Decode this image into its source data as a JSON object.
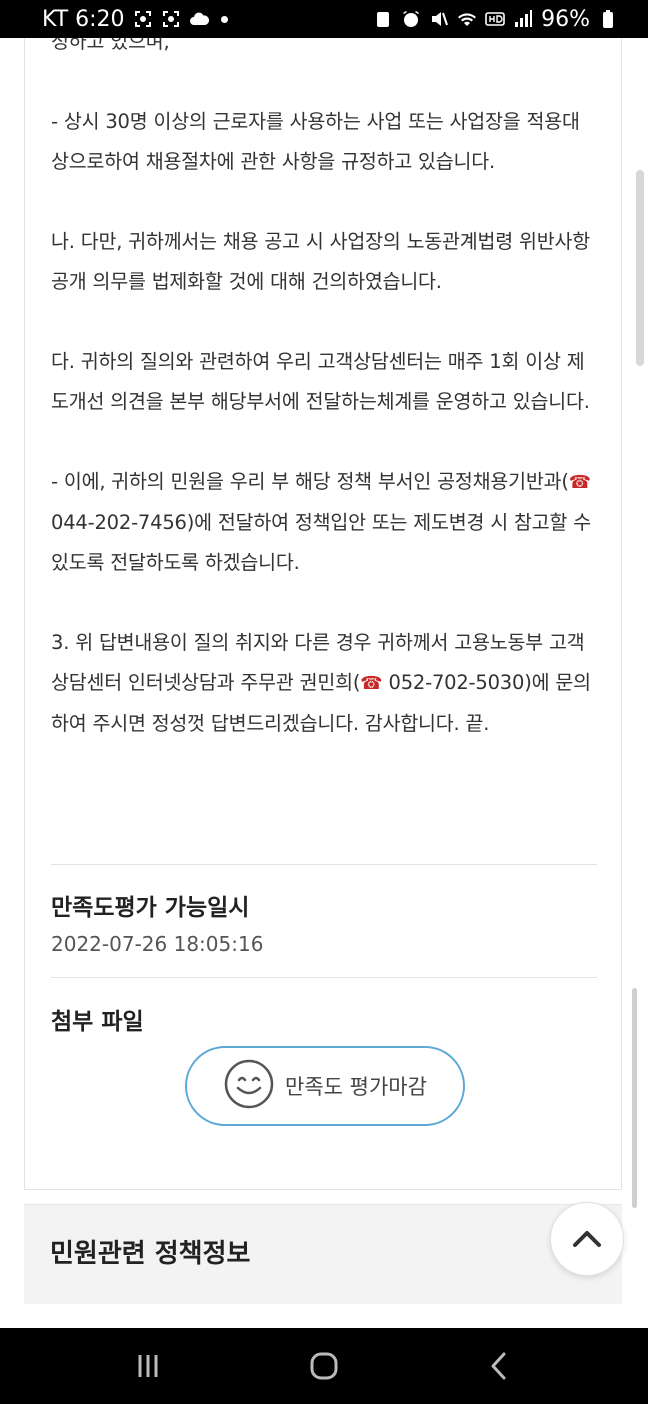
{
  "status_bar": {
    "carrier_time": "KT 6:20",
    "battery": "96%",
    "icons": [
      "screenshot-icon",
      "screenshot-icon",
      "cloud-icon",
      "notification-dot",
      "lock-icon",
      "alarm-icon",
      "mute-icon",
      "wifi-icon",
      "hd-icon",
      "signal-icon",
      "battery-icon"
    ]
  },
  "answer": {
    "top_fragment": "정하고 있으며,",
    "p1": "- 상시 30명 이상의 근로자를 사용하는 사업 또는 사업장을 적용대상으로하여 채용절차에 관한 사항을 규정하고 있습니다.",
    "p2": "나. 다만, 귀하께서는 채용 공고 시 사업장의 노동관계법령 위반사항 공개 의무를 법제화할 것에 대해 건의하였습니다.",
    "p3": "다. 귀하의 질의와 관련하여 우리 고객상담센터는 매주 1회 이상 제도개선 의견을 본부 해당부서에 전달하는체계를 운영하고 있습니다.",
    "p4_before": "- 이에, 귀하의 민원을 우리 부 해당 정책 부서인 공정채용기반과(",
    "p4_tel": "044-202-7456",
    "p4_after": ")에 전달하여 정책입안 또는 제도변경 시 참고할 수 있도록 전달하도록 하겠습니다.",
    "p5_before": "3. 위 답변내용이 질의 취지와 다른 경우 귀하께서 고용노동부 고객상담센터 인터넷상담과 주무관 권민희(",
    "p5_tel": "052-702-5030",
    "p5_after": ")에 문의하여 주시면 정성껏 답변드리겠습니다. 감사합니다. 끝."
  },
  "satisfaction": {
    "label": "만족도평가 가능일시",
    "datetime": "2022-07-26 18:05:16"
  },
  "attachment": {
    "label": "첨부 파일"
  },
  "rate_button": {
    "label": "만족도 평가마감",
    "icon": "smile-icon"
  },
  "policy": {
    "title": "민원관련 정책정보"
  },
  "colors": {
    "accent_border": "#5da9d6",
    "phone_icon": "#c62828"
  }
}
